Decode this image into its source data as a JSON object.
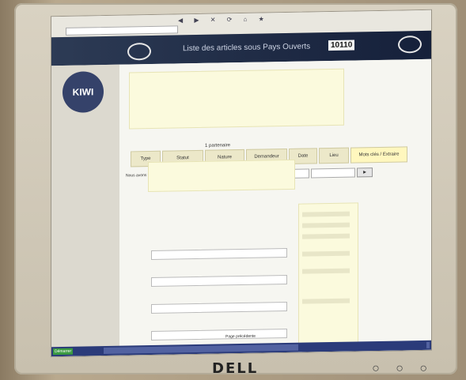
{
  "browser": {
    "title": "",
    "address": ""
  },
  "header": {
    "app_name": "",
    "title": "Liste des articles sous Pays Ouverts",
    "code": "10110"
  },
  "sidebar": {
    "logo": "KIWI",
    "items": [
      "",
      "",
      "",
      "",
      "",
      "",
      "",
      "",
      "",
      "",
      "",
      "",
      "",
      "",
      "",
      "",
      "",
      "",
      "",
      ""
    ]
  },
  "content": {
    "subtitle": "1 partenaire",
    "tabs": [
      "Type",
      "Statut",
      "Nature",
      "Demandeur",
      "Date",
      "Lieu",
      "Mots clés / Extraire"
    ],
    "filter_label": "Nous avons trouvé",
    "bottom_note": "Page précédente"
  },
  "taskbar": {
    "items": [
      "Démarrer",
      "",
      "",
      "",
      "",
      ""
    ],
    "clock": ""
  },
  "colors": {
    "header_bg": "#1e2a44",
    "sidebar_bg": "#dcd9cf",
    "panel_yellow": "#fbfadd",
    "taskbar_bg": "#2b3b7a"
  }
}
